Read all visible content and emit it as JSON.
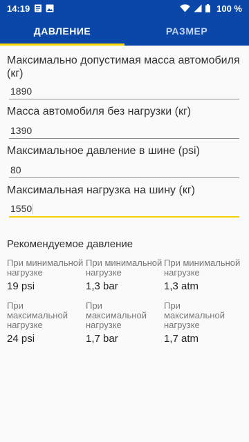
{
  "status_bar": {
    "time": "14:19",
    "battery_percent": "100 %",
    "icons": [
      "notification-doc-icon",
      "image-icon",
      "wifi-icon",
      "signal-icon",
      "battery-icon"
    ]
  },
  "tabs": [
    {
      "label": "ДАВЛЕНИЕ",
      "active": true
    },
    {
      "label": "РАЗМЕР",
      "active": false
    }
  ],
  "form": {
    "max_mass": {
      "label": "Максимально допустимая масса автомобиля (кг)",
      "value": "1890"
    },
    "empty_mass": {
      "label": "Масса автомобиля без нагрузки (кг)",
      "value": "1390"
    },
    "max_pressure": {
      "label": "Максимальное давление в шине (psi)",
      "value": "80"
    },
    "max_load": {
      "label": "Максимальная нагрузка на шину (кг)",
      "value": "1550"
    }
  },
  "recommended": {
    "title": "Рекомендуемое давление",
    "min_row": [
      {
        "caption": "При минимальной нагрузке",
        "value": "19 psi"
      },
      {
        "caption": "При минимальной нагрузке",
        "value": "1,3 bar"
      },
      {
        "caption": "При минимальной нагрузке",
        "value": "1,3 atm"
      }
    ],
    "max_row": [
      {
        "caption": "При максимальной нагрузке",
        "value": "24 psi"
      },
      {
        "caption": "При максимальной нагрузке",
        "value": "1,7 bar"
      },
      {
        "caption": "При максимальной нагрузке",
        "value": "1,7 atm"
      }
    ]
  },
  "colors": {
    "appbar": "#0a47a8",
    "tab_indicator": "#ffd600",
    "focus_underline": "#f2d200"
  }
}
